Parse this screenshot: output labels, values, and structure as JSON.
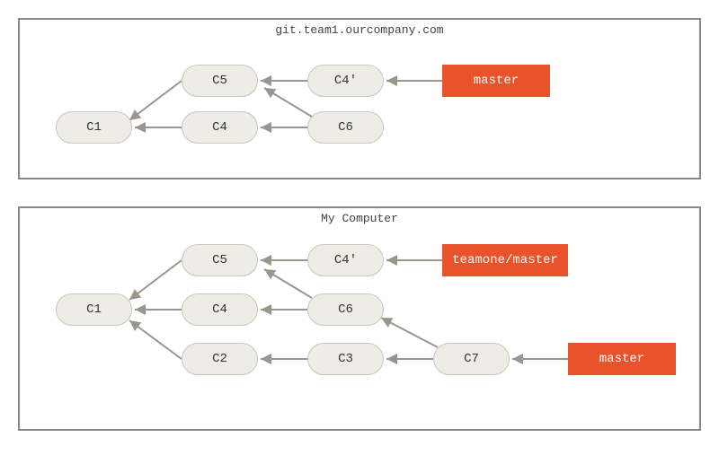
{
  "top_panel": {
    "title": "git.team1.ourcompany.com",
    "commits": {
      "c1": "C1",
      "c4": "C4",
      "c5": "C5",
      "c6": "C6",
      "c4p": "C4'"
    },
    "refs": {
      "master": "master"
    }
  },
  "bottom_panel": {
    "title": "My Computer",
    "commits": {
      "c1": "C1",
      "c2": "C2",
      "c3": "C3",
      "c4": "C4",
      "c5": "C5",
      "c6": "C6",
      "c7": "C7",
      "c4p": "C4'"
    },
    "refs": {
      "teamone_master": "teamone/master",
      "master": "master"
    }
  }
}
